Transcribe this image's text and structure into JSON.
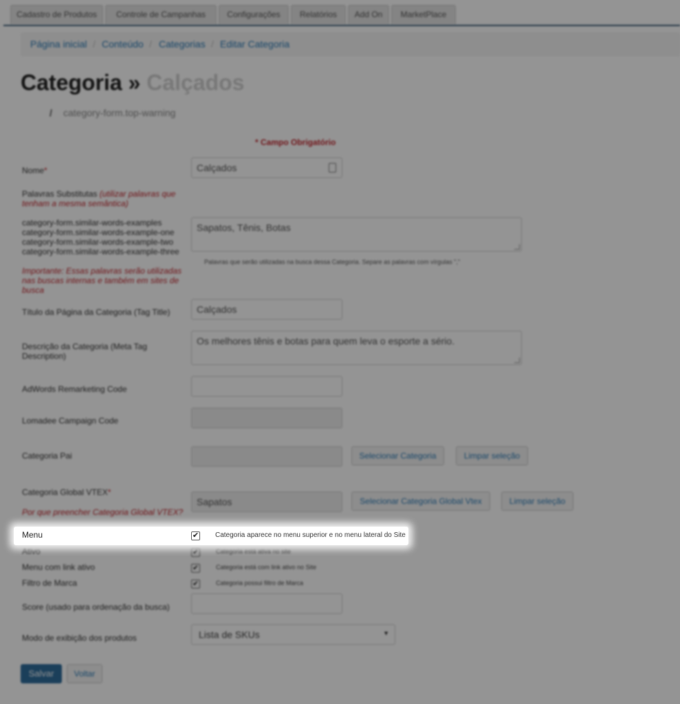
{
  "top_tabs": [
    "Cadastro de Produtos",
    "Controle de Campanhas",
    "Configurações",
    "Relatórios",
    "Add On",
    "MarketPlace"
  ],
  "breadcrumb": [
    "Página inicial",
    "Conteúdo",
    "Categorias",
    "Editar Categoria"
  ],
  "breadcrumb_separator": "/",
  "page_title": {
    "main": "Categoria »",
    "sub": "Calçados"
  },
  "top_warning": {
    "icon": "/",
    "text": "category-form.top-warning"
  },
  "required_notice": "* Campo Obrigatório",
  "form": {
    "name": {
      "label": "Nome",
      "required": "*",
      "value": "Calçados"
    },
    "substitute_words": {
      "label": "Palavras Substitutas",
      "hint": "(utilizar palavras que tenham a mesma semântica)",
      "examples": [
        "category-form.similar-words-examples",
        "category-form.similar-words-example-one",
        "category-form.similar-words-example-two",
        "category-form.similar-words-example-three"
      ],
      "important": "Importante: Essas palavras serão utilizadas nas buscas internas e também em sites de busca",
      "value": "Sapatos, Tênis, Botas",
      "help": "Palavras que serão utilizadas na busca dessa Categoria. Separe as palavras com vírgulas \",\""
    },
    "page_title": {
      "label": "Título da Página da Categoria (Tag Title)",
      "value": "Calçados"
    },
    "meta_description": {
      "label": "Descrição da Categoria (Meta Tag Description)",
      "value": "Os melhores tênis e botas para quem leva o esporte a sério."
    },
    "adwords": {
      "label": "AdWords Remarketing Code",
      "value": ""
    },
    "lomadee": {
      "label": "Lomadee Campaign Code",
      "value": ""
    },
    "parent_category": {
      "label": "Categoria Pai",
      "value": "",
      "select_button": "Selecionar Categoria",
      "clear_button": "Limpar seleção"
    },
    "global_category": {
      "label": "Categoria Global VTEX",
      "required": "*",
      "why": "Por que preencher Categoria Global VTEX?",
      "value": "Sapatos",
      "select_button": "Selecionar Categoria Global Vtex",
      "clear_button": "Limpar seleção"
    },
    "menu": {
      "label": "Menu",
      "checked": "✔",
      "desc": "Categoria aparece no menu superior e no menu lateral do Site"
    },
    "active": {
      "label": "Ativo",
      "checked": "✔",
      "desc": "Categoria está ativa no site"
    },
    "menu_link": {
      "label": "Menu com link ativo",
      "checked": "✔",
      "desc": "Categoria está com link ativo no Site"
    },
    "brand_filter": {
      "label": "Filtro de Marca",
      "checked": "✔",
      "desc": "Categoria possui filtro de Marca"
    },
    "score": {
      "label": "Score (usado para ordenação da busca)",
      "value": ""
    },
    "display_mode": {
      "label": "Modo de exibição dos produtos",
      "value": "Lista de SKUs",
      "arrow": "▼"
    }
  },
  "actions": {
    "save": "Salvar",
    "back": "Voltar"
  }
}
